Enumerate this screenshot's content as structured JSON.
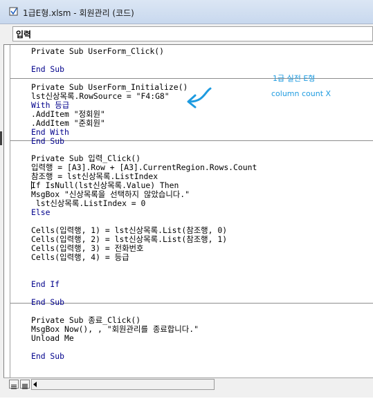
{
  "window": {
    "title": "1급E형.xlsm - 회원관리 (코드)"
  },
  "object_combo": {
    "value": "입력"
  },
  "code_lines": [
    {
      "text": "Private Sub UserForm_Click()"
    },
    {
      "text": "End Sub"
    },
    {
      "text": "Private Sub UserForm_Initialize()"
    },
    {
      "text": "lst신상목록.RowSource = \"F4:G8\""
    },
    {
      "text": "With 등급"
    },
    {
      "text": ".AddItem \"정회원\""
    },
    {
      "text": ".AddItem \"준회원\""
    },
    {
      "text": "End With"
    },
    {
      "text": "End Sub"
    },
    {
      "text": "Private Sub 입력_Click()"
    },
    {
      "text": "입력행 = [A3].Row + [A3].CurrentRegion.Rows.Count"
    },
    {
      "text": "참조행 = lst신상목록.ListIndex"
    },
    {
      "text": "If IsNull(lst신상목록.Value) Then"
    },
    {
      "text": "MsgBox \"신상목록을 선택하지 않았습니다.\""
    },
    {
      "text": " lst신상목록.ListIndex = 0"
    },
    {
      "text": "Else"
    },
    {
      "text": "Cells(입력행, 1) = lst신상목록.List(참조행, 0)"
    },
    {
      "text": "Cells(입력행, 2) = lst신상목록.List(참조행, 1)"
    },
    {
      "text": "Cells(입력행, 3) = 전화번호"
    },
    {
      "text": "Cells(입력행, 4) = 등급"
    },
    {
      "text": "End If"
    },
    {
      "text": "End Sub"
    },
    {
      "text": "Private Sub 종료_Click()"
    },
    {
      "text": "MsgBox Now(), , \"회원관리를 종료합니다.\""
    },
    {
      "text": "Unload Me"
    },
    {
      "text": "End Sub"
    }
  ],
  "annotation": {
    "line1": "1급 실전 E형",
    "line2": "column count X",
    "color": "#1e9be0"
  },
  "icons": {
    "title": "vba-module-icon",
    "procedure_view": "procedure-view-icon",
    "full_module_view": "full-module-view-icon",
    "scroll_left": "scroll-left-arrow-icon"
  }
}
